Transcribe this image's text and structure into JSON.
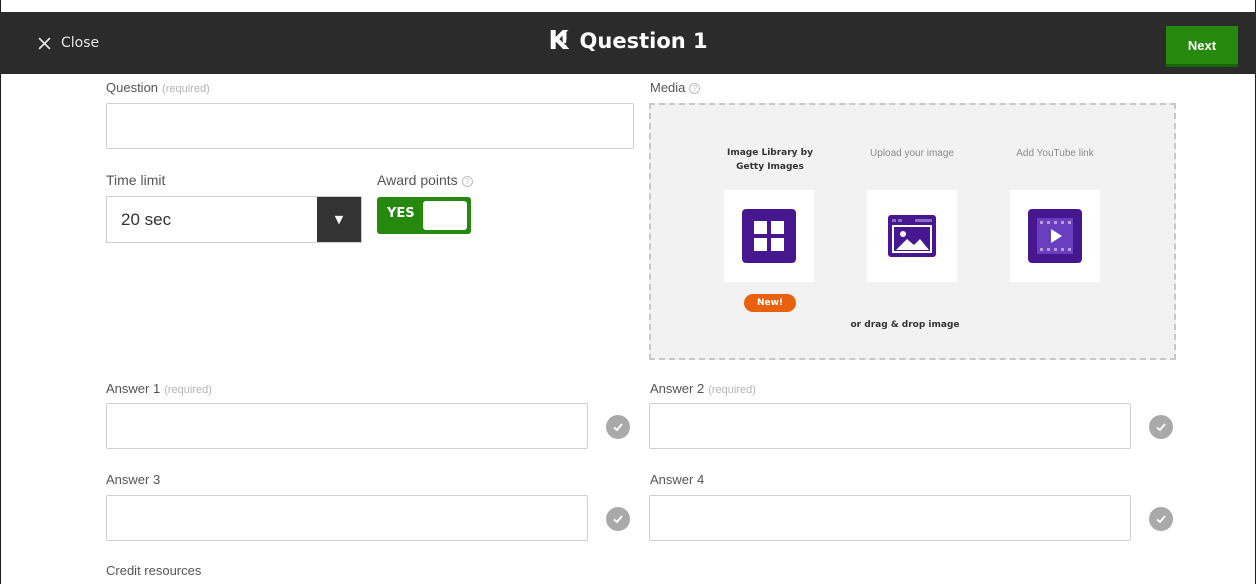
{
  "topbar": {
    "close_label": "Close",
    "logo": "K",
    "logo_mark": "!",
    "title": "Question 1",
    "next_label": "Next"
  },
  "question": {
    "label": "Question",
    "required": "(required)",
    "value": ""
  },
  "time_limit": {
    "label": "Time limit",
    "value": "20 sec"
  },
  "award_points": {
    "label": "Award points",
    "toggle_label": "YES",
    "enabled": true
  },
  "media": {
    "label": "Media",
    "options": [
      {
        "label_line1": "Image Library by",
        "label_line2": "Getty Images",
        "icon": "grid-icon",
        "badge": "New!"
      },
      {
        "label": "Upload your image",
        "icon": "image-upload-icon"
      },
      {
        "label": "Add YouTube link",
        "icon": "video-icon"
      }
    ],
    "drag_drop": "or drag & drop image"
  },
  "answers": [
    {
      "label": "Answer 1",
      "required": "(required)",
      "value": ""
    },
    {
      "label": "Answer 2",
      "required": "(required)",
      "value": ""
    },
    {
      "label": "Answer 3",
      "required": "",
      "value": ""
    },
    {
      "label": "Answer 4",
      "required": "",
      "value": ""
    }
  ],
  "credit": {
    "label": "Credit resources"
  },
  "colors": {
    "topbar": "#2b2b2b",
    "next": "#26890d",
    "media_icon": "#46178f",
    "badge": "#e8620e"
  }
}
